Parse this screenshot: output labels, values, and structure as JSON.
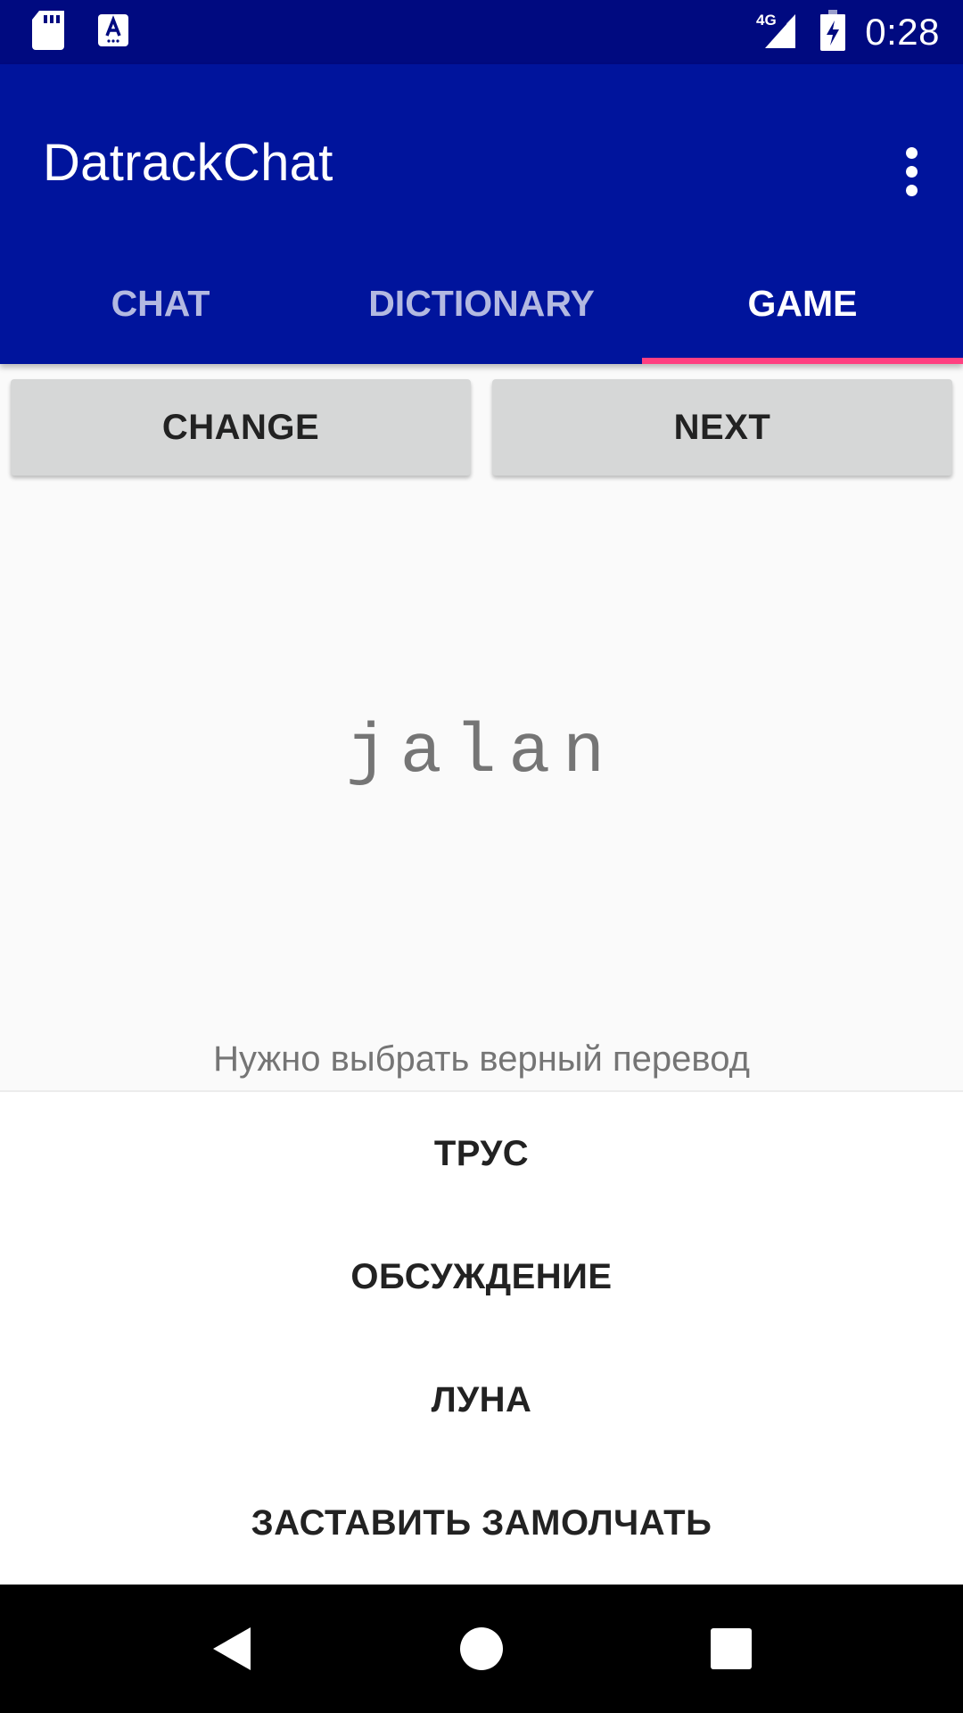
{
  "status_bar": {
    "time": "0:28",
    "network": "4G",
    "icons": [
      "sd-card-icon",
      "keyboard-a-icon",
      "signal-4g-icon",
      "battery-charging-icon"
    ]
  },
  "app_bar": {
    "title": "DatrackChat",
    "menu_icon": "overflow-menu-icon"
  },
  "tabs": [
    {
      "label": "CHAT",
      "active": false
    },
    {
      "label": "DICTIONARY",
      "active": false
    },
    {
      "label": "GAME",
      "active": true
    }
  ],
  "actions": {
    "change_label": "CHANGE",
    "next_label": "NEXT"
  },
  "game": {
    "word": "jalan",
    "prompt": "Нужно выбрать верный перевод",
    "answers": [
      "ТРУС",
      "ОБСУЖДЕНИЕ",
      "ЛУНА",
      "ЗАСТАВИТЬ ЗАМОЛЧАТЬ"
    ]
  },
  "nav_bar": {
    "icons": [
      "back-icon",
      "home-icon",
      "recents-icon"
    ]
  },
  "colors": {
    "status_bar": "#000a80",
    "primary": "#00149c",
    "accent": "#ff4081"
  }
}
